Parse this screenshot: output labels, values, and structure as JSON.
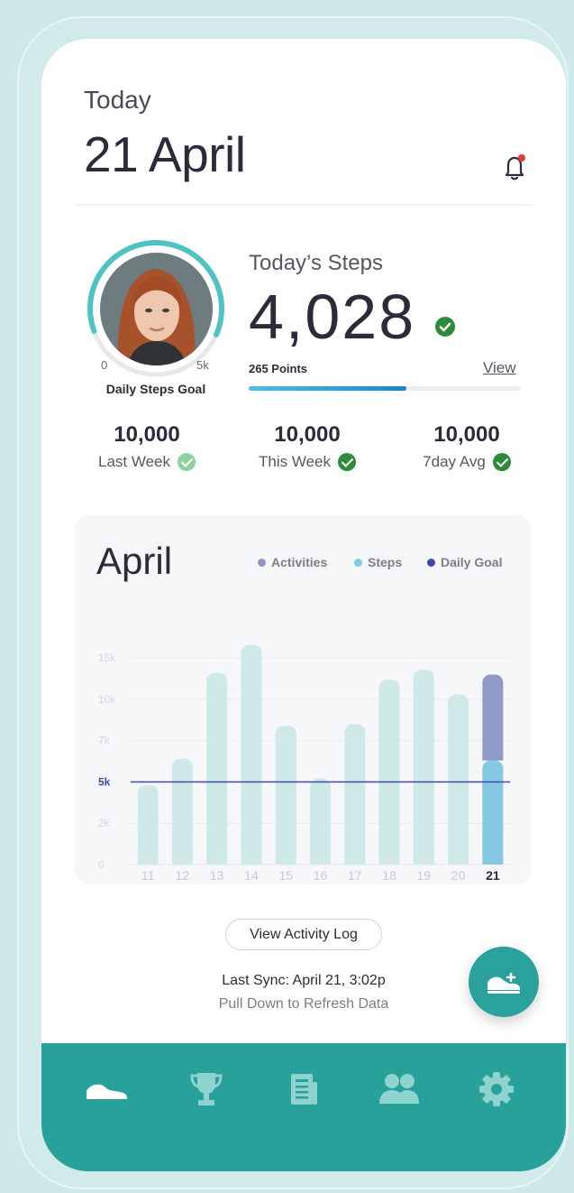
{
  "header": {
    "subtitle": "Today",
    "date": "21 April",
    "notification_icon": "bell-icon"
  },
  "goal_ring": {
    "min_label": "0",
    "max_label": "5k",
    "caption": "Daily Steps Goal",
    "progress_fraction": 0.62,
    "ring_color": "#4fc3c2"
  },
  "today": {
    "label": "Today’s Steps",
    "steps": "4,028",
    "points": "265 Points",
    "view_link": "View",
    "points_progress_percent": 58
  },
  "stats": [
    {
      "value": "10,000",
      "label": "Last Week",
      "check_color": "#8fd19e"
    },
    {
      "value": "10,000",
      "label": "This Week",
      "check_color": "#2e8b3d"
    },
    {
      "value": "10,000",
      "label": "7day Avg",
      "check_color": "#2e8b3d"
    }
  ],
  "chart_data": {
    "type": "bar",
    "title": "April",
    "legend": [
      {
        "label": "Activities",
        "color": "#8b96c7"
      },
      {
        "label": "Steps",
        "color": "#7ccbe6"
      },
      {
        "label": "Daily Goal",
        "color": "#3d4aa6"
      }
    ],
    "categories": [
      "11",
      "12",
      "13",
      "14",
      "15",
      "16",
      "17",
      "18",
      "19",
      "20",
      "21"
    ],
    "highlight_category": "21",
    "y_ticks": [
      "0",
      "2k",
      "5k",
      "7k",
      "10k",
      "15k"
    ],
    "y_tick_values": [
      0,
      2500,
      5000,
      7500,
      10000,
      12500
    ],
    "goal_label": "5k",
    "goal_value": 5000,
    "ylim": [
      0,
      13000
    ],
    "series": [
      {
        "name": "Steps",
        "values": [
          4800,
          6400,
          11600,
          13300,
          8400,
          5200,
          8500,
          11200,
          11800,
          10300,
          6300
        ]
      },
      {
        "name": "Activities",
        "values": [
          0,
          0,
          0,
          0,
          0,
          0,
          0,
          0,
          0,
          0,
          5200
        ]
      }
    ],
    "colors": {
      "past_bars": "#cfe9e8",
      "steps_today": "#86c8e2",
      "activities_today": "#8e9bc9",
      "goal_line": "#3d4aa6"
    },
    "grid": true
  },
  "activity": {
    "button_label": "View Activity Log",
    "last_sync": "Last Sync: April 21, 3:02p",
    "refresh_hint": "Pull Down to Refresh Data",
    "fab_icon": "add-activity-shoe-icon"
  },
  "tabbar": {
    "items": [
      {
        "icon": "shoe-icon",
        "active": true
      },
      {
        "icon": "trophy-icon",
        "active": false
      },
      {
        "icon": "newspaper-icon",
        "active": false
      },
      {
        "icon": "users-icon",
        "active": false
      },
      {
        "icon": "gear-icon",
        "active": false
      }
    ],
    "color": "#29a19b"
  }
}
